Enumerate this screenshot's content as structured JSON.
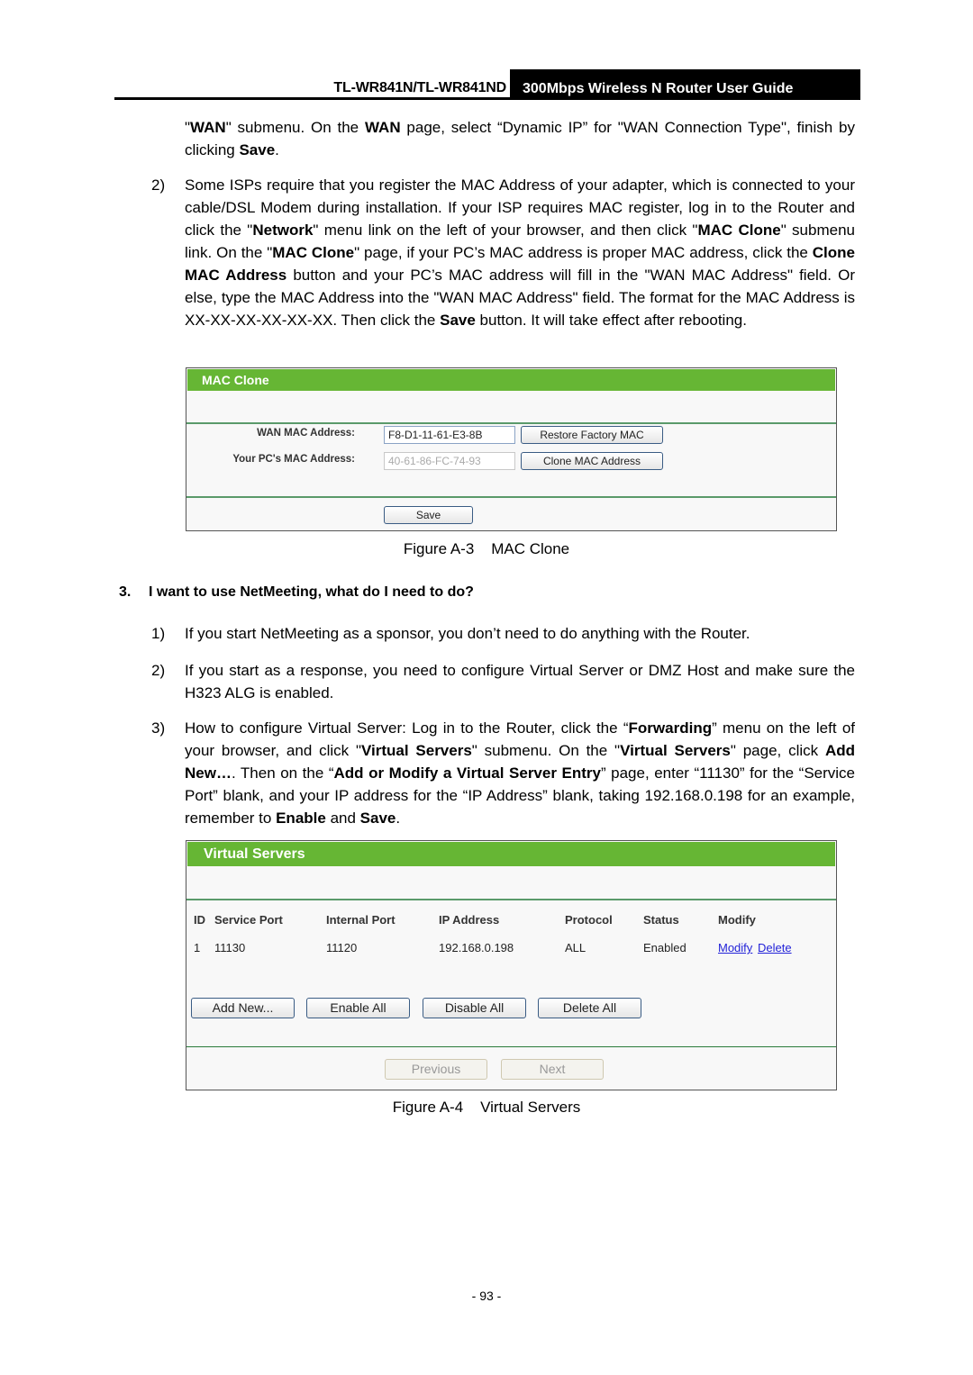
{
  "header": {
    "model": "TL-WR841N/TL-WR841ND",
    "guide_title": "300Mbps Wireless N Router User Guide"
  },
  "intro_continuation": {
    "parts": [
      {
        "t": "\"",
        "b": false
      },
      {
        "t": "WAN",
        "b": true
      },
      {
        "t": "\" submenu. On the ",
        "b": false
      },
      {
        "t": "WAN",
        "b": true
      },
      {
        "t": " page, select “Dynamic IP” for \"WAN Connection Type\", finish by clicking ",
        "b": false
      },
      {
        "t": "Save",
        "b": true
      },
      {
        "t": ".",
        "b": false
      }
    ]
  },
  "step2_mac": {
    "number": "2)",
    "parts": [
      {
        "t": "Some ISPs require that you register the MAC Address of your adapter, which is connected to your cable/DSL Modem during installation. If your ISP requires MAC register, log in to the Router and click the \"",
        "b": false
      },
      {
        "t": "Network",
        "b": true
      },
      {
        "t": "\" menu link on the left of your browser, and then click \"",
        "b": false
      },
      {
        "t": "MAC Clone",
        "b": true
      },
      {
        "t": "\" submenu link. On the \"",
        "b": false
      },
      {
        "t": "MAC Clone",
        "b": true
      },
      {
        "t": "\" page, if your PC’s MAC address is proper MAC address, click the ",
        "b": false
      },
      {
        "t": "Clone MAC Address",
        "b": true
      },
      {
        "t": " button and your PC’s MAC address will fill in the \"WAN MAC Address\" field. Or else, type the MAC Address into the \"WAN MAC Address\" field. The format for the MAC Address is XX-XX-XX-XX-XX-XX. Then click the ",
        "b": false
      },
      {
        "t": "Save",
        "b": true
      },
      {
        "t": " button. It will take effect after rebooting.",
        "b": false
      }
    ]
  },
  "mac_clone_panel": {
    "title": "MAC Clone",
    "wan_mac_label": "WAN MAC Address:",
    "wan_mac_value": "F8-D1-11-61-E3-8B",
    "pc_mac_label": "Your PC's MAC Address:",
    "pc_mac_value": "40-61-86-FC-74-93",
    "restore_button": "Restore Factory MAC",
    "clone_button": "Clone MAC Address",
    "save_button": "Save"
  },
  "figure_a3": {
    "number": "Figure A-3",
    "title": "MAC Clone"
  },
  "question3": {
    "number": "3.",
    "text": "I want to use NetMeeting, what do I need to do?"
  },
  "q3_step1": {
    "number": "1)",
    "text": "If you start NetMeeting as a sponsor, you don’t need to do anything with the Router."
  },
  "q3_step2": {
    "number": "2)",
    "text": "If you start as a response, you need to configure Virtual Server or DMZ Host and make sure the H323 ALG is enabled."
  },
  "q3_step3": {
    "number": "3)",
    "parts": [
      {
        "t": "How to configure Virtual Server: Log in to the Router, click the “",
        "b": false
      },
      {
        "t": "Forwarding",
        "b": true
      },
      {
        "t": "” menu on the left of your browser, and click \"",
        "b": false
      },
      {
        "t": "Virtual Servers",
        "b": true
      },
      {
        "t": "\" submenu. On the \"",
        "b": false
      },
      {
        "t": "Virtual Servers",
        "b": true
      },
      {
        "t": "\" page, click ",
        "b": false
      },
      {
        "t": "Add New…",
        "b": true
      },
      {
        "t": ". Then on the “",
        "b": false
      },
      {
        "t": "Add or Modify a Virtual Server Entry",
        "b": true
      },
      {
        "t": "” page, enter “11130” for the “Service Port” blank, and your IP address for the “IP Address” blank, taking 192.168.0.198 for an example, remember to ",
        "b": false
      },
      {
        "t": "Enable",
        "b": true
      },
      {
        "t": " and ",
        "b": false
      },
      {
        "t": "Save",
        "b": true
      },
      {
        "t": ".",
        "b": false
      }
    ]
  },
  "virtual_servers_panel": {
    "title": "Virtual Servers",
    "columns": [
      "ID",
      "Service Port",
      "Internal Port",
      "IP Address",
      "Protocol",
      "Status",
      "Modify"
    ],
    "rows": [
      {
        "id": "1",
        "service_port": "11130",
        "internal_port": "11120",
        "ip": "192.168.0.198",
        "protocol": "ALL",
        "status": "Enabled",
        "modify_link": "Modify",
        "delete_link": "Delete"
      }
    ],
    "buttons": {
      "add_new": "Add New...",
      "enable_all": "Enable All",
      "disable_all": "Disable All",
      "delete_all": "Delete All"
    },
    "pager": {
      "previous": "Previous",
      "next": "Next"
    }
  },
  "figure_a4": {
    "number": "Figure A-4",
    "title": "Virtual Servers"
  },
  "page_number": "- 93 -"
}
